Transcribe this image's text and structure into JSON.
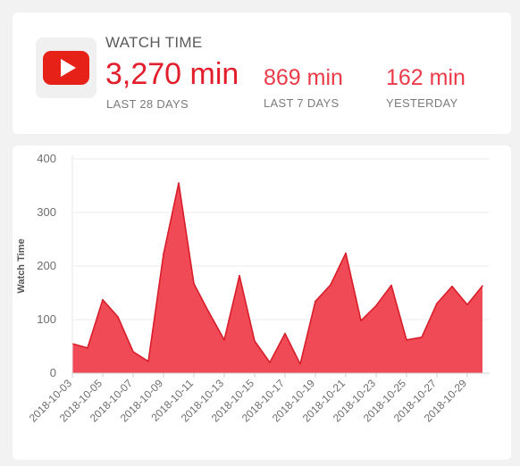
{
  "kpis": {
    "title": "WATCH TIME",
    "main": {
      "value": "3,270 min",
      "label": "LAST 28 DAYS"
    },
    "last7": {
      "value": "869 min",
      "label": "LAST 7 DAYS"
    },
    "yesterday": {
      "value": "162 min",
      "label": "YESTERDAY"
    }
  },
  "colors": {
    "accent": "#e31e2c",
    "area_fill": "#f04a56",
    "line": "#d81e2a",
    "logo_red": "#e62117"
  },
  "icons": {
    "logo": "youtube-play-icon"
  },
  "chart_data": {
    "type": "area",
    "ylabel": "Watch Time",
    "xlabel": "",
    "ylim": [
      0,
      400
    ],
    "yticks": [
      0,
      100,
      200,
      300,
      400
    ],
    "grid": true,
    "x": [
      "2018-10-03",
      "2018-10-04",
      "2018-10-05",
      "2018-10-06",
      "2018-10-07",
      "2018-10-08",
      "2018-10-09",
      "2018-10-10",
      "2018-10-11",
      "2018-10-12",
      "2018-10-13",
      "2018-10-14",
      "2018-10-15",
      "2018-10-16",
      "2018-10-17",
      "2018-10-18",
      "2018-10-19",
      "2018-10-20",
      "2018-10-21",
      "2018-10-22",
      "2018-10-23",
      "2018-10-24",
      "2018-10-25",
      "2018-10-26",
      "2018-10-27",
      "2018-10-28",
      "2018-10-29",
      "2018-10-30"
    ],
    "xticks": [
      "2018-10-03",
      "2018-10-05",
      "2018-10-07",
      "2018-10-09",
      "2018-10-11",
      "2018-10-13",
      "2018-10-15",
      "2018-10-17",
      "2018-10-19",
      "2018-10-21",
      "2018-10-23",
      "2018-10-25",
      "2018-10-27",
      "2018-10-29"
    ],
    "values": [
      55,
      47,
      137,
      105,
      40,
      22,
      222,
      355,
      167,
      113,
      62,
      182,
      60,
      20,
      74,
      17,
      134,
      165,
      224,
      98,
      126,
      164,
      62,
      67,
      130,
      162,
      128,
      163
    ]
  }
}
